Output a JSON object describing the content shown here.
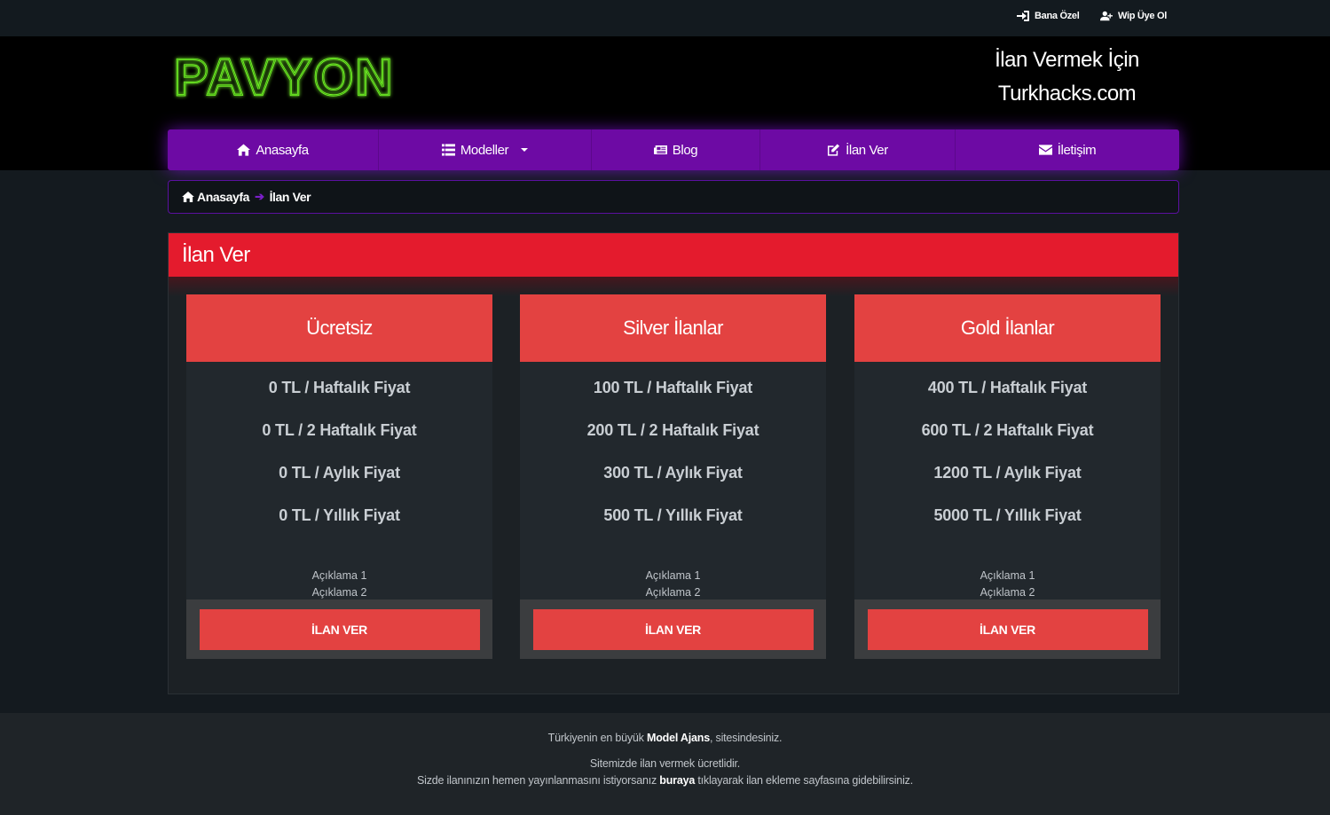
{
  "topbar": {
    "links": [
      {
        "label": "Bana Özel",
        "icon": "sign-in-icon"
      },
      {
        "label": "Wip Üye Ol",
        "icon": "user-plus-icon"
      }
    ]
  },
  "header": {
    "logo_text": "PAVYON",
    "promo_line1": "İlan Vermek İçin",
    "promo_line2": "Turkhacks.com"
  },
  "nav": {
    "items": [
      {
        "label": "Anasayfa",
        "icon": "home-icon"
      },
      {
        "label": "Modeller",
        "icon": "list-icon"
      },
      {
        "label": "Blog",
        "icon": "newspaper-icon"
      },
      {
        "label": "İlan Ver",
        "icon": "edit-icon"
      },
      {
        "label": "İletişim",
        "icon": "envelope-icon"
      }
    ]
  },
  "breadcrumb": {
    "home": "Anasayfa",
    "current": "İlan Ver"
  },
  "panel": {
    "title": "İlan Ver"
  },
  "plans": [
    {
      "title": "Ücretsiz",
      "prices": [
        "0 TL / Haftalık Fiyat",
        "0 TL / 2 Haftalık Fiyat",
        "0 TL / Aylık Fiyat",
        "0 TL / Yıllık Fiyat"
      ],
      "desc1": "Açıklama 1",
      "desc2": "Açıklama 2",
      "button": "İLAN VER"
    },
    {
      "title": "Silver İlanlar",
      "prices": [
        "100 TL / Haftalık Fiyat",
        "200 TL / 2 Haftalık Fiyat",
        "300 TL / Aylık Fiyat",
        "500 TL / Yıllık Fiyat"
      ],
      "desc1": "Açıklama 1",
      "desc2": "Açıklama 2",
      "button": "İLAN VER"
    },
    {
      "title": "Gold İlanlar",
      "prices": [
        "400 TL / Haftalık Fiyat",
        "600 TL / 2 Haftalık Fiyat",
        "1200 TL / Aylık Fiyat",
        "5000 TL / Yıllık Fiyat"
      ],
      "desc1": "Açıklama 1",
      "desc2": "Açıklama 2",
      "button": "İLAN VER"
    }
  ],
  "footer": {
    "line1_pre": "Türkiyenin en büyük ",
    "line1_bold": "Model Ajans",
    "line1_post": ", sitesindesiniz.",
    "line2": "Sitemizde ilan vermek ücretlidir.",
    "line3_pre": "Sizde ilanınızın hemen yayınlanmasını istiyorsanız ",
    "line3_link": "buraya",
    "line3_post": " tıklayarak ilan ekleme sayfasına gidebilirsiniz."
  },
  "colors": {
    "nav": "#6d0aa4",
    "panel_header": "#e41b2d",
    "card_accent": "#e34241",
    "logo_neon": "#7cff2a"
  }
}
